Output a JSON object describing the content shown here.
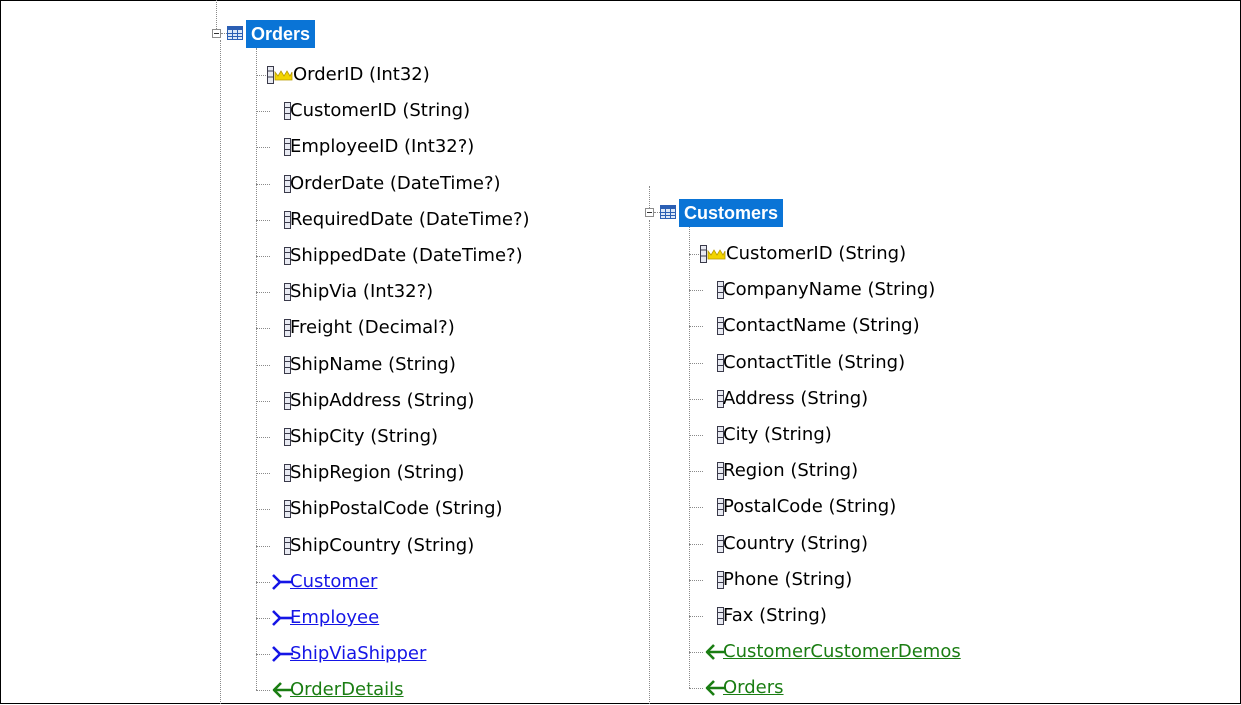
{
  "colors": {
    "selection": "#0a74d6",
    "outgoing_link": "#1515e6",
    "incoming_link": "#1a7d12",
    "primary_key_icon": "#e8c800"
  },
  "orders": {
    "title": "Orders",
    "columns": [
      {
        "label": "OrderID (Int32)",
        "icon": "primary-key-icon"
      },
      {
        "label": "CustomerID (String)",
        "icon": "column-icon"
      },
      {
        "label": "EmployeeID (Int32?)",
        "icon": "column-icon"
      },
      {
        "label": "OrderDate (DateTime?)",
        "icon": "column-icon"
      },
      {
        "label": "RequiredDate (DateTime?)",
        "icon": "column-icon"
      },
      {
        "label": "ShippedDate (DateTime?)",
        "icon": "column-icon"
      },
      {
        "label": "ShipVia (Int32?)",
        "icon": "column-icon"
      },
      {
        "label": "Freight (Decimal?)",
        "icon": "column-icon"
      },
      {
        "label": "ShipName (String)",
        "icon": "column-icon"
      },
      {
        "label": "ShipAddress (String)",
        "icon": "column-icon"
      },
      {
        "label": "ShipCity (String)",
        "icon": "column-icon"
      },
      {
        "label": "ShipRegion (String)",
        "icon": "column-icon"
      },
      {
        "label": "ShipPostalCode (String)",
        "icon": "column-icon"
      },
      {
        "label": "ShipCountry (String)",
        "icon": "column-icon"
      }
    ],
    "relations": [
      {
        "label": "Customer",
        "icon": "many-to-one-arrow-icon"
      },
      {
        "label": "Employee",
        "icon": "many-to-one-arrow-icon"
      },
      {
        "label": "ShipViaShipper",
        "icon": "many-to-one-arrow-icon"
      },
      {
        "label": "OrderDetails",
        "icon": "one-to-many-arrow-icon"
      }
    ]
  },
  "customers": {
    "title": "Customers",
    "columns": [
      {
        "label": "CustomerID (String)",
        "icon": "primary-key-icon"
      },
      {
        "label": "CompanyName (String)",
        "icon": "column-icon"
      },
      {
        "label": "ContactName (String)",
        "icon": "column-icon"
      },
      {
        "label": "ContactTitle (String)",
        "icon": "column-icon"
      },
      {
        "label": "Address (String)",
        "icon": "column-icon"
      },
      {
        "label": "City (String)",
        "icon": "column-icon"
      },
      {
        "label": "Region (String)",
        "icon": "column-icon"
      },
      {
        "label": "PostalCode (String)",
        "icon": "column-icon"
      },
      {
        "label": "Country (String)",
        "icon": "column-icon"
      },
      {
        "label": "Phone (String)",
        "icon": "column-icon"
      },
      {
        "label": "Fax (String)",
        "icon": "column-icon"
      }
    ],
    "relations": [
      {
        "label": "CustomerCustomerDemos",
        "icon": "one-to-many-arrow-icon"
      },
      {
        "label": "Orders",
        "icon": "one-to-many-arrow-icon"
      }
    ]
  }
}
